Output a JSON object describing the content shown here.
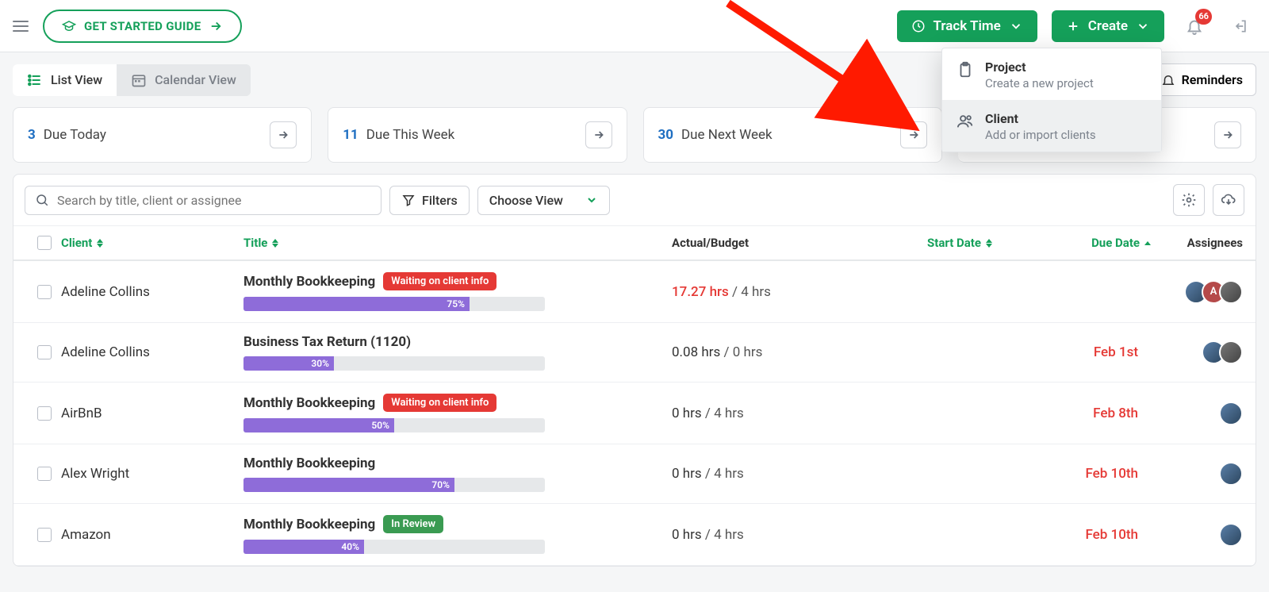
{
  "header": {
    "guide_label": "GET STARTED GUIDE",
    "track_time_label": "Track Time",
    "create_label": "Create",
    "notification_count": "66"
  },
  "create_menu": {
    "items": [
      {
        "title": "Project",
        "sub": "Create a new project"
      },
      {
        "title": "Client",
        "sub": "Add or import clients"
      }
    ]
  },
  "views": {
    "list": "List View",
    "calendar": "Calendar View",
    "reminders": "Reminders"
  },
  "cards": [
    {
      "count": "3",
      "label": "Due Today"
    },
    {
      "count": "11",
      "label": "Due This Week"
    },
    {
      "count": "30",
      "label": "Due Next Week"
    },
    {
      "count": "",
      "label": ""
    }
  ],
  "toolbar": {
    "search_placeholder": "Search by title, client or assignee",
    "filters_label": "Filters",
    "choose_view_label": "Choose View"
  },
  "columns": {
    "client": "Client",
    "title": "Title",
    "actual_budget": "Actual/Budget",
    "start_date": "Start Date",
    "due_date": "Due Date",
    "assignees": "Assignees"
  },
  "rows": [
    {
      "client": "Adeline Collins",
      "title": "Monthly Bookkeeping",
      "tag": "Waiting on client info",
      "tag_color": "red",
      "progress": 75,
      "actual": "17.27 hrs",
      "actual_over": true,
      "budget": "4 hrs",
      "start": "",
      "due": "",
      "avatars": [
        "img1",
        "letter:A",
        "img2"
      ]
    },
    {
      "client": "Adeline Collins",
      "title": "Business Tax Return (1120)",
      "tag": "",
      "tag_color": "",
      "progress": 30,
      "actual": "0.08 hrs",
      "actual_over": false,
      "budget": "0 hrs",
      "start": "",
      "due": "Feb 1st",
      "avatars": [
        "img1",
        "img2"
      ]
    },
    {
      "client": "AirBnB",
      "title": "Monthly Bookkeeping",
      "tag": "Waiting on client info",
      "tag_color": "red",
      "progress": 50,
      "actual": "0 hrs",
      "actual_over": false,
      "budget": "4 hrs",
      "start": "",
      "due": "Feb 8th",
      "avatars": [
        "img1"
      ]
    },
    {
      "client": "Alex Wright",
      "title": "Monthly Bookkeeping",
      "tag": "",
      "tag_color": "",
      "progress": 70,
      "actual": "0 hrs",
      "actual_over": false,
      "budget": "4 hrs",
      "start": "",
      "due": "Feb 10th",
      "avatars": [
        "img1"
      ]
    },
    {
      "client": "Amazon",
      "title": "Monthly Bookkeeping",
      "tag": "In Review",
      "tag_color": "green",
      "progress": 40,
      "actual": "0 hrs",
      "actual_over": false,
      "budget": "4 hrs",
      "start": "",
      "due": "Feb 10th",
      "avatars": [
        "img1"
      ]
    }
  ]
}
